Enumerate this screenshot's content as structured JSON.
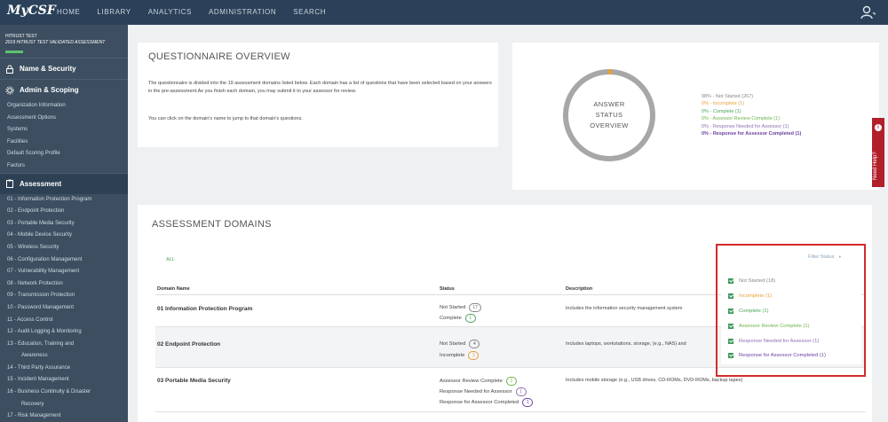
{
  "app": {
    "logo": "MyCSF"
  },
  "nav": {
    "items": [
      "HOME",
      "LIBRARY",
      "ANALYTICS",
      "ADMINISTRATION",
      "SEARCH"
    ]
  },
  "colors": {
    "not_started": "#888888",
    "incomplete": "#e8a13a",
    "complete": "#4aa35a",
    "assessor_review_complete": "#6fb34b",
    "response_needed": "#8e6fb0",
    "response_for_assessor_completed": "#6a3fa0",
    "progress": "#5cc36e"
  },
  "sidebar": {
    "org": "HITRUST TEST",
    "assessment": "2019 HITRUST TEST VALIDATED ASSESSMENT",
    "progress_fraction": 0.03,
    "section_name_security": "Name & Security",
    "section_admin": "Admin & Scoping",
    "admin_items": [
      "Organization Information",
      "Assessment Options",
      "Systems",
      "Facilities",
      "Default Scoring Profile",
      "Factors"
    ],
    "section_assessment": "Assessment",
    "assessment_items": [
      "01 - Information Protection Program",
      "02 - Endpoint Protection",
      "03 - Portable Media Security",
      "04 - Mobile Device Security",
      "05 - Wireless Security",
      "06 - Configuration Management",
      "07 - Vulnerability Management",
      "08 - Network Protection",
      "09 - Transmission Protection",
      "10 - Password Management",
      "11 - Access Control",
      "12 - Audit Logging & Monitoring",
      "13 - Education, Training and",
      "Awareness",
      "14 - Third Party Assurance",
      "15 - Incident Management",
      "16 - Business Continuity & Disaster",
      "Recovery",
      "17 - Risk Management"
    ]
  },
  "overview": {
    "title": "QUESTIONNAIRE OVERVIEW",
    "para1": "The questionnaire is divided into the 19 assessment domains listed below. Each domain has a list of questions that have been selected based on your answers in the pre-assessment.As you finish each domain, you may submit it to your assessor for review.",
    "para2": "You can click on the domain's name to jump to that domain's questions."
  },
  "status_overview": {
    "label_line1": "ANSWER",
    "label_line2": "STATUS",
    "label_line3": "OVERVIEW",
    "legend": [
      "98% - Not Started (267)",
      "0% - Incomplete (1)",
      "0% - Complete (1)",
      "0% - Assessor Review Complete (1)",
      "0% - Response Needed for Assessor (1)",
      "0% - Response for Assessor Completed (1)"
    ]
  },
  "need_help": {
    "label": "Need Help?",
    "icon": "info-icon"
  },
  "domains": {
    "title": "ASSESSMENT DOMAINS",
    "all_link": "ALL",
    "filter_label": "Filter Status",
    "columns": [
      "Domain Name",
      "Status",
      "Description"
    ],
    "rows": [
      {
        "name": "01 Information Protection Program",
        "statuses": [
          {
            "label": "Not Started",
            "count": "17"
          },
          {
            "label": "Complete",
            "count": "1"
          }
        ],
        "description": "Includes the information security management system"
      },
      {
        "name": "02 Endpoint Protection",
        "statuses": [
          {
            "label": "Not Started",
            "count": "4"
          },
          {
            "label": "Incomplete",
            "count": "1"
          }
        ],
        "description": "Includes laptops, workstations, storage, (e.g., NAS) and"
      },
      {
        "name": "03 Portable Media Security",
        "statuses": [
          {
            "label": "Assessor Review Complete",
            "count": "1"
          },
          {
            "label": "Response Needed for Assessor",
            "count": "1"
          },
          {
            "label": "Response for Assessor Completed",
            "count": "1"
          }
        ],
        "description": "Includes mobile storage (e.g., USB drives, CD-ROMs, DVD-ROMs, backup tapes)"
      }
    ]
  },
  "filter_menu": {
    "items": [
      "Not Started (18)",
      "Incomplete (1)",
      "Complete (1)",
      "Assessor Review Complete (1)",
      "Response Needed for Assessor (1)",
      "Response for Assessor Completed (1)"
    ]
  }
}
